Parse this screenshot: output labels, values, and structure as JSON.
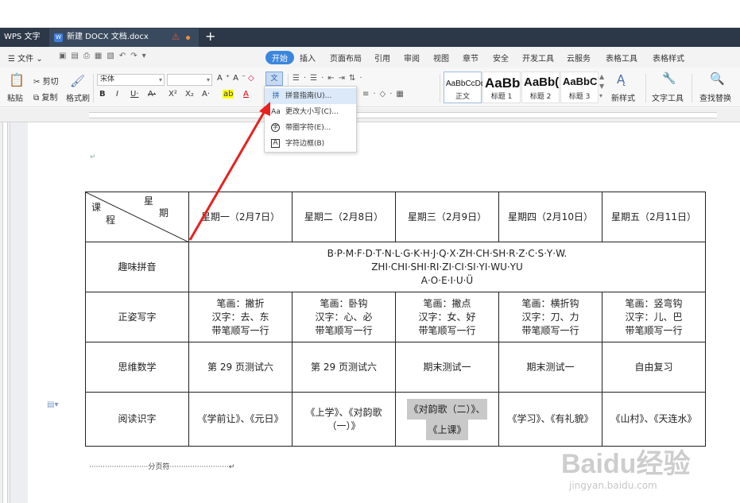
{
  "tabs": {
    "app": "WPS 文字",
    "doc": "新建 DOCX 文档.docx",
    "add": "+"
  },
  "menu": {
    "file": "文件",
    "items": [
      "开始",
      "插入",
      "页面布局",
      "引用",
      "审阅",
      "视图",
      "章节",
      "安全",
      "开发工具",
      "云服务",
      "表格工具",
      "表格样式"
    ]
  },
  "ribbon": {
    "paste": "粘贴",
    "cut": "剪切",
    "copy": "复制",
    "format_painter": "格式刷",
    "font_name": "宋体",
    "font_size": "",
    "styles": [
      {
        "sample": "AaBbCcDd",
        "name": "正文"
      },
      {
        "sample": "AaBb",
        "name": "标题 1"
      },
      {
        "sample": "AaBb(",
        "name": "标题 2"
      },
      {
        "sample": "AaBbC",
        "name": "标题 3"
      }
    ],
    "new_style": "新样式",
    "text_tools": "文字工具",
    "find_replace": "查找替换"
  },
  "dropdown": {
    "items": [
      {
        "icon": "拼",
        "label": "拼音指南(U)..."
      },
      {
        "icon": "Aa",
        "label": "更改大小写(C)..."
      },
      {
        "icon": "字",
        "label": "带圈字符(E)..."
      },
      {
        "icon": "A",
        "label": "字符边框(B)"
      }
    ]
  },
  "table": {
    "corner": {
      "top": "星",
      "top2": "期",
      "left": "课",
      "left2": "程"
    },
    "days": [
      "星期一（2月7日）",
      "星期二（2月8日）",
      "星期三（2月9日）",
      "星期四（2月10日）",
      "星期五（2月11日）"
    ],
    "rows": [
      {
        "label": "趣味拼音",
        "merged": [
          "B·P·M·F·D·T·N·L·G·K·H·J·Q·X·ZH·CH·SH·R·Z·C·S·Y·W.",
          "ZHI·CHI·SHI·RI·ZI·CI·SI·YI·WU·YU",
          "A·O·E·I·U·Ü"
        ]
      },
      {
        "label": "正姿写字",
        "cells": [
          [
            "笔画：撇折",
            "汉字：去、东",
            "带笔顺写一行"
          ],
          [
            "笔画：卧钩",
            "汉字：心、必",
            "带笔顺写一行"
          ],
          [
            "笔画：撇点",
            "汉字：女、好",
            "带笔顺写一行"
          ],
          [
            "笔画：横折钩",
            "汉字：刀、力",
            "带笔顺写一行"
          ],
          [
            "笔画：竖弯钩",
            "汉字：儿、巴",
            "带笔顺写一行"
          ]
        ]
      },
      {
        "label": "思维数学",
        "cells": [
          "第 29 页测试六",
          "第 29 页测试六",
          "期末测试一",
          "期末测试一",
          "自由复习"
        ]
      },
      {
        "label": "阅读识字",
        "cells": [
          "《学前让》、《元日》",
          "《上学》、《对韵歌（一）》",
          "《对韵歌（二）》、",
          "《学习》、《有礼貌》",
          "《山村》、《天连水》"
        ],
        "highlight_second_line": "《上课》"
      }
    ]
  },
  "page_break": "分页符",
  "watermark": {
    "main": "Baidu经验",
    "sub": "jingyan.baidu.com"
  }
}
